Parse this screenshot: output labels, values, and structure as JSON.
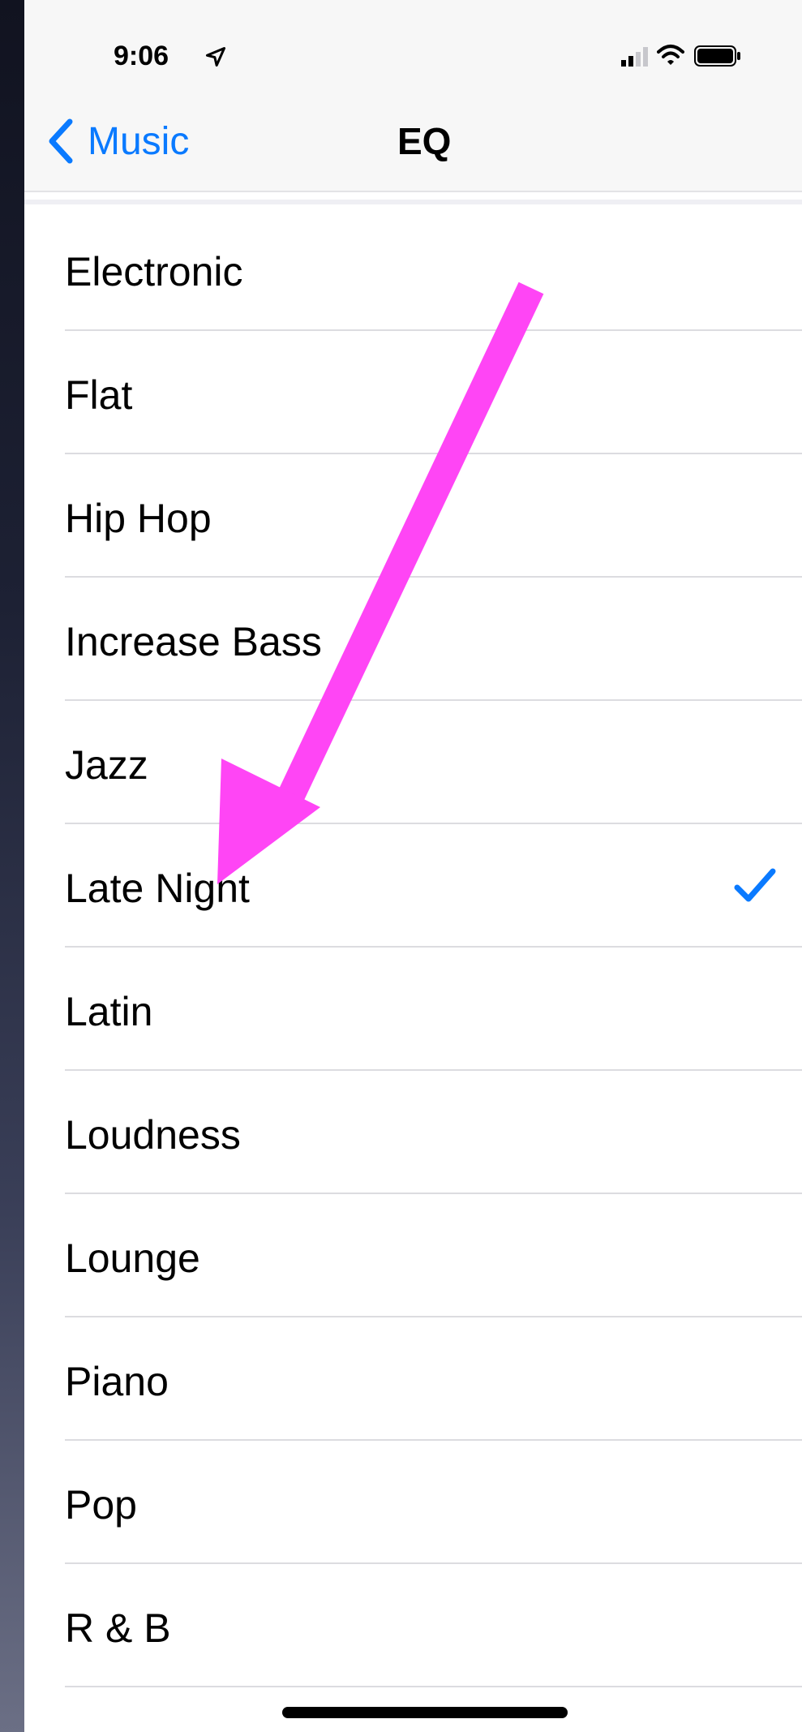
{
  "status_bar": {
    "time": "9:06",
    "icons": [
      "location-arrow-icon",
      "cellular-signal-icon",
      "wifi-icon",
      "battery-icon"
    ]
  },
  "nav": {
    "back_label": "Music",
    "title": "EQ"
  },
  "eq_presets": [
    {
      "label": "Electronic",
      "selected": false
    },
    {
      "label": "Flat",
      "selected": false
    },
    {
      "label": "Hip Hop",
      "selected": false
    },
    {
      "label": "Increase Bass",
      "selected": false
    },
    {
      "label": "Jazz",
      "selected": false
    },
    {
      "label": "Late Night",
      "selected": true
    },
    {
      "label": "Latin",
      "selected": false
    },
    {
      "label": "Loudness",
      "selected": false
    },
    {
      "label": "Lounge",
      "selected": false
    },
    {
      "label": "Piano",
      "selected": false
    },
    {
      "label": "Pop",
      "selected": false
    },
    {
      "label": "R & B",
      "selected": false
    }
  ],
  "colors": {
    "accent": "#0a7aff",
    "annotation_arrow": "#ff45f5"
  }
}
